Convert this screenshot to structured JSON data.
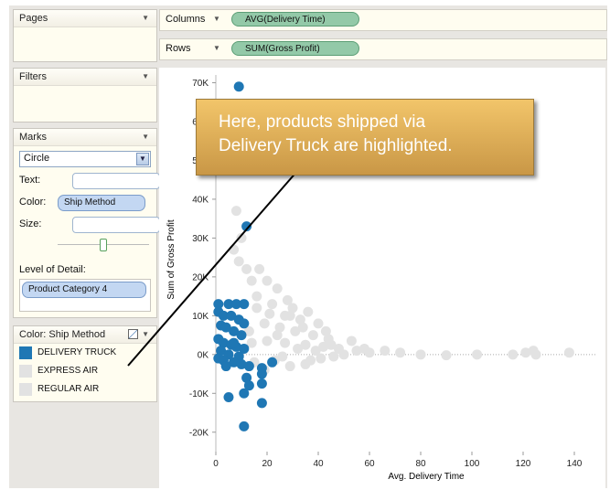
{
  "panels": {
    "pages": "Pages",
    "filters": "Filters",
    "marks": "Marks"
  },
  "shelves": {
    "columns_label": "Columns",
    "columns_pill": "AVG(Delivery Time)",
    "rows_label": "Rows",
    "rows_pill": "SUM(Gross Profit)"
  },
  "marks": {
    "type": "Circle",
    "text_label": "Text:",
    "color_label": "Color:",
    "color_pill": "Ship Method",
    "size_label": "Size:",
    "lod_label": "Level of Detail:",
    "lod_pill": "Product Category 4"
  },
  "legend": {
    "title": "Color: Ship Method",
    "items": [
      {
        "label": "DELIVERY TRUCK",
        "color": "#1f77b4"
      },
      {
        "label": "EXPRESS AIR",
        "color": "#e2e2e2"
      },
      {
        "label": "REGULAR AIR",
        "color": "#e2e2e2"
      }
    ]
  },
  "callout": {
    "line1": "Here, products shipped via",
    "line2": "Delivery Truck are highlighted."
  },
  "colors": {
    "highlight": "#1f77b4",
    "muted": "#e2e2e2",
    "callout_fill": "#e0ad55"
  },
  "chart_data": {
    "type": "scatter",
    "xlabel": "Avg. Delivery Time",
    "ylabel": "Sum of Gross Profit",
    "xlim": [
      0,
      145
    ],
    "ylim": [
      -25000,
      72000
    ],
    "xticks": [
      "0",
      "20",
      "40",
      "60",
      "80",
      "100",
      "120",
      "140"
    ],
    "yticks": [
      "70K",
      "60K",
      "50K",
      "40K",
      "30K",
      "20K",
      "10K",
      "0K",
      "-10K",
      "-20K"
    ],
    "series": [
      {
        "name": "DELIVERY TRUCK",
        "color": "#1f77b4",
        "points": [
          [
            9,
            69000
          ],
          [
            12,
            33000
          ],
          [
            1,
            13000
          ],
          [
            5,
            13000
          ],
          [
            8,
            13000
          ],
          [
            11,
            13000
          ],
          [
            1,
            11000
          ],
          [
            3,
            10000
          ],
          [
            6,
            10000
          ],
          [
            9,
            9000
          ],
          [
            11,
            8000
          ],
          [
            2,
            7500
          ],
          [
            4,
            7000
          ],
          [
            7,
            6000
          ],
          [
            10,
            5000
          ],
          [
            1,
            4000
          ],
          [
            3,
            3000
          ],
          [
            6,
            2500
          ],
          [
            8,
            2000
          ],
          [
            11,
            1500
          ],
          [
            2,
            1000
          ],
          [
            5,
            0
          ],
          [
            9,
            -500
          ],
          [
            1,
            -1000
          ],
          [
            3,
            -1500
          ],
          [
            7,
            -2000
          ],
          [
            10,
            -2500
          ],
          [
            13,
            -3000
          ],
          [
            18,
            -3500
          ],
          [
            22,
            -2000
          ],
          [
            12,
            -6000
          ],
          [
            18,
            -5000
          ],
          [
            18,
            -7500
          ],
          [
            13,
            -8000
          ],
          [
            5,
            -11000
          ],
          [
            11,
            -10000
          ],
          [
            18,
            -12500
          ],
          [
            11,
            -18500
          ],
          [
            7,
            3000
          ],
          [
            4,
            -3000
          ]
        ]
      },
      {
        "name": "EXPRESS AIR / REGULAR AIR",
        "color": "#e2e2e2",
        "points": [
          [
            8,
            37000
          ],
          [
            10,
            30000
          ],
          [
            7,
            27000
          ],
          [
            9,
            24000
          ],
          [
            12,
            22000
          ],
          [
            17,
            22000
          ],
          [
            14,
            19000
          ],
          [
            20,
            19000
          ],
          [
            24,
            17000
          ],
          [
            16,
            15000
          ],
          [
            28,
            14000
          ],
          [
            22,
            13000
          ],
          [
            30,
            12000
          ],
          [
            36,
            11000
          ],
          [
            27,
            10000
          ],
          [
            33,
            9000
          ],
          [
            40,
            8000
          ],
          [
            25,
            7000
          ],
          [
            31,
            6000
          ],
          [
            38,
            5000
          ],
          [
            44,
            4000
          ],
          [
            20,
            3500
          ],
          [
            27,
            3000
          ],
          [
            35,
            2500
          ],
          [
            42,
            2000
          ],
          [
            48,
            1500
          ],
          [
            55,
            1000
          ],
          [
            60,
            500
          ],
          [
            66,
            1000
          ],
          [
            72,
            500
          ],
          [
            80,
            0
          ],
          [
            90,
            -200
          ],
          [
            102,
            0
          ],
          [
            116,
            0
          ],
          [
            121,
            500
          ],
          [
            124,
            1000
          ],
          [
            125,
            0
          ],
          [
            138,
            500
          ],
          [
            15,
            -2000
          ],
          [
            23,
            -1500
          ],
          [
            29,
            -3000
          ],
          [
            35,
            -2500
          ],
          [
            41,
            -1000
          ],
          [
            19,
            8000
          ],
          [
            24,
            5000
          ],
          [
            16,
            12000
          ],
          [
            21,
            10500
          ],
          [
            34,
            7000
          ],
          [
            39,
            1000
          ],
          [
            45,
            2500
          ],
          [
            50,
            0
          ],
          [
            14,
            3000
          ],
          [
            26,
            -500
          ],
          [
            32,
            1500
          ],
          [
            46,
            -500
          ],
          [
            19,
            -4000
          ],
          [
            13,
            6000
          ],
          [
            37,
            -1500
          ],
          [
            43,
            6000
          ],
          [
            29,
            10000
          ],
          [
            53,
            3500
          ],
          [
            58,
            1500
          ]
        ]
      }
    ]
  }
}
